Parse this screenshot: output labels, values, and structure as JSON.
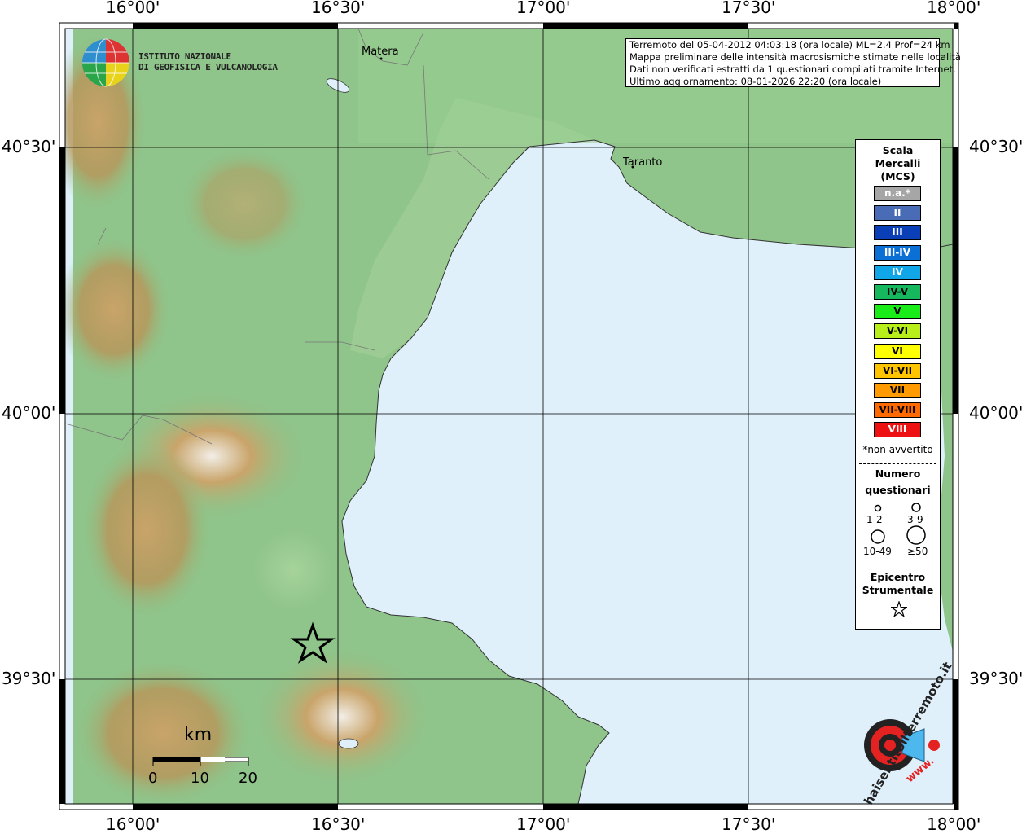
{
  "map": {
    "lon_ticks": [
      "16°00'",
      "16°30'",
      "17°00'",
      "17°30'",
      "18°00'"
    ],
    "lat_ticks": [
      "40°30'",
      "40°00'",
      "39°30'"
    ],
    "cities": [
      "Matera",
      "Taranto"
    ],
    "land_color": "#8fc48a",
    "sea_color": "#dff0fb"
  },
  "logo": {
    "line1": "ISTITUTO NAZIONALE",
    "line2": "DI GEOFISICA E VULCANOLOGIA"
  },
  "info": {
    "line1": "Terremoto del 05-04-2012 04:03:18 (ora locale) ML=2.4 Prof=24 km",
    "line2": "Mappa preliminare delle intensità macrosismiche stimate nelle località",
    "line3": "Dati non verificati estratti da 1 questionari compilati tramite Internet.",
    "line4": "Ultimo aggiornamento: 08-01-2026 22:20 (ora locale)"
  },
  "legend": {
    "title1": "Scala",
    "title2": "Mercalli",
    "title3": "(MCS)",
    "items": [
      {
        "label": "n.a.*",
        "color": "#a6a6a6",
        "text_color": "#ffffff"
      },
      {
        "label": "II",
        "color": "#4a6bb5",
        "text_color": "#ffffff"
      },
      {
        "label": "III",
        "color": "#0b3fb8",
        "text_color": "#ffffff"
      },
      {
        "label": "III-IV",
        "color": "#0a70d6",
        "text_color": "#ffffff"
      },
      {
        "label": "IV",
        "color": "#10a6e8",
        "text_color": "#ffffff"
      },
      {
        "label": "IV-V",
        "color": "#16b85e",
        "text_color": "#000000"
      },
      {
        "label": "V",
        "color": "#1aec1a",
        "text_color": "#000000"
      },
      {
        "label": "V-VI",
        "color": "#b8ee1a",
        "text_color": "#000000"
      },
      {
        "label": "VI",
        "color": "#ffff00",
        "text_color": "#000000"
      },
      {
        "label": "VI-VII",
        "color": "#ffc400",
        "text_color": "#000000"
      },
      {
        "label": "VII",
        "color": "#ff9a00",
        "text_color": "#000000"
      },
      {
        "label": "VII-VIII",
        "color": "#ff6a00",
        "text_color": "#000000"
      },
      {
        "label": "VIII",
        "color": "#ee1111",
        "text_color": "#ffffff"
      }
    ],
    "note": "*non avvertito",
    "count_title1": "Numero",
    "count_title2": "questionari",
    "counts": [
      "1-2",
      "3-9",
      "10-49",
      "≥50"
    ],
    "epi_title1": "Epicentro",
    "epi_title2": "Strumentale"
  },
  "scale": {
    "unit": "km",
    "labels": [
      "0",
      "10",
      "20"
    ]
  },
  "brand": {
    "text": "haisentitoilterremoto.it",
    "www": "www."
  }
}
